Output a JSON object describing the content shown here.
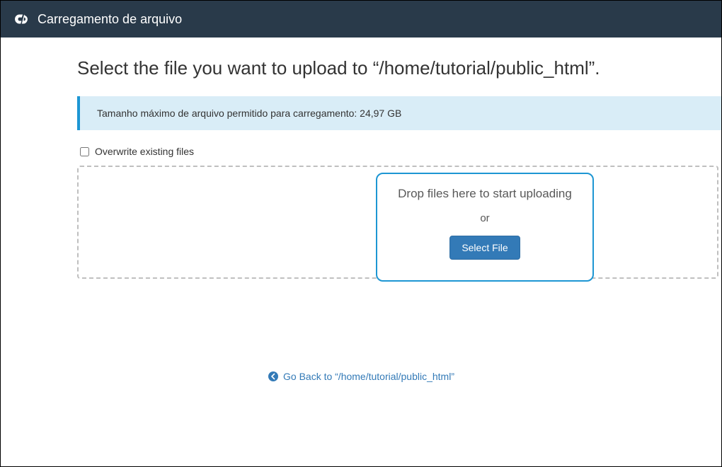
{
  "header": {
    "title": "Carregamento de arquivo"
  },
  "page": {
    "title": "Select the file you want to upload to “/home/tutorial/public_html”.",
    "info_banner": "Tamanho máximo de arquivo permitido para carregamento: 24,97 GB",
    "overwrite_label": "Overwrite existing files"
  },
  "dropzone": {
    "instruction": "Drop files here to start uploading",
    "or": "or",
    "select_button": "Select File"
  },
  "goback": {
    "label": "Go Back to “/home/tutorial/public_html”"
  }
}
